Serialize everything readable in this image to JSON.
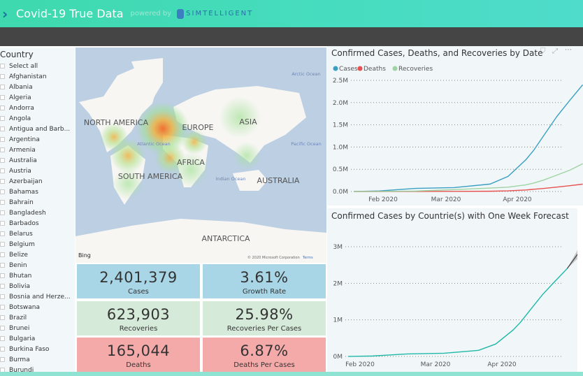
{
  "header": {
    "title": "Covid-19 True Data",
    "powered_by": "powered by",
    "brand": "SIMTELLIGENT",
    "colors": {
      "accent": "#3ed9ae",
      "bar": "#454545"
    }
  },
  "slicer": {
    "title": "Country",
    "items": [
      "Select all",
      "Afghanistan",
      "Albania",
      "Algeria",
      "Andorra",
      "Angola",
      "Antigua and Barb...",
      "Argentina",
      "Armenia",
      "Australia",
      "Austria",
      "Azerbaijan",
      "Bahamas",
      "Bahrain",
      "Bangladesh",
      "Barbados",
      "Belarus",
      "Belgium",
      "Belize",
      "Benin",
      "Bhutan",
      "Bolivia",
      "Bosnia and Herze...",
      "Botswana",
      "Brazil",
      "Brunei",
      "Bulgaria",
      "Burkina Faso",
      "Burma",
      "Burundi"
    ]
  },
  "map": {
    "labels": {
      "na": "NORTH AMERICA",
      "sa": "SOUTH AMERICA",
      "eu": "EUROPE",
      "af": "AFRICA",
      "as": "ASIA",
      "au": "AUSTRALIA",
      "an": "ANTARCTICA",
      "atl": "Atlantic Ocean",
      "ind": "Indian Ocean",
      "pac": "Pacific Ocean",
      "arc": "Arctic Ocean"
    },
    "bing": "Bing",
    "copyright": "© 2020 Microsoft Corporation",
    "terms": "Terms"
  },
  "kpis": [
    {
      "value": "2,401,379",
      "label": "Cases",
      "color": "#a8d6e6"
    },
    {
      "value": "3.61%",
      "label": "Growth Rate",
      "color": "#a8d6e6"
    },
    {
      "value": "623,903",
      "label": "Recoveries",
      "color": "#d5ead8"
    },
    {
      "value": "25.98%",
      "label": "Recoveries Per Cases",
      "color": "#d5ead8"
    },
    {
      "value": "165,044",
      "label": "Deaths",
      "color": "#f5aaaa"
    },
    {
      "value": "6.87%",
      "label": "Deaths Per Cases",
      "color": "#f5aaaa"
    }
  ],
  "chart_data": [
    {
      "type": "line",
      "title": "Confirmed Cases, Deaths, and Recoveries by Date",
      "legend": "top-left",
      "grid": true,
      "xticks": [
        "Feb 2020",
        "Mar 2020",
        "Apr 2020"
      ],
      "yticks": [
        "0.0M",
        "0.5M",
        "1.0M",
        "1.5M",
        "2.0M",
        "2.5M"
      ],
      "ylim": [
        0,
        2.5
      ],
      "x": [
        "2020-01-22",
        "2020-02-01",
        "2020-02-15",
        "2020-03-01",
        "2020-03-15",
        "2020-03-22",
        "2020-03-29",
        "2020-04-01",
        "2020-04-05",
        "2020-04-10",
        "2020-04-15",
        "2020-04-20"
      ],
      "series": [
        {
          "name": "Cases",
          "color": "#3a9fc2",
          "values": [
            0.0006,
            0.012,
            0.069,
            0.088,
            0.167,
            0.34,
            0.72,
            0.93,
            1.27,
            1.69,
            2.05,
            2.4
          ]
        },
        {
          "name": "Deaths",
          "color": "#e8514f",
          "values": [
            0,
            0,
            0.001,
            0.003,
            0.006,
            0.015,
            0.034,
            0.05,
            0.069,
            0.1,
            0.13,
            0.165
          ]
        },
        {
          "name": "Recoveries",
          "color": "#9fd3a3",
          "values": [
            0,
            0.001,
            0.01,
            0.043,
            0.077,
            0.097,
            0.15,
            0.19,
            0.26,
            0.37,
            0.48,
            0.624
          ]
        }
      ]
    },
    {
      "type": "line",
      "title": "Confirmed Cases by Countrie(s) with One Week Forecast",
      "grid": true,
      "xticks": [
        "Feb 2020",
        "Mar 2020",
        "Apr 2020"
      ],
      "yticks": [
        "0M",
        "1M",
        "2M",
        "3M"
      ],
      "ylim": [
        0,
        3
      ],
      "x": [
        "2020-01-22",
        "2020-02-01",
        "2020-02-15",
        "2020-03-01",
        "2020-03-15",
        "2020-03-22",
        "2020-03-29",
        "2020-04-01",
        "2020-04-05",
        "2020-04-10",
        "2020-04-15",
        "2020-04-20"
      ],
      "series": [
        {
          "name": "Cases",
          "color": "#1fb8a8",
          "values": [
            0.0006,
            0.012,
            0.069,
            0.088,
            0.167,
            0.34,
            0.72,
            0.93,
            1.27,
            1.69,
            2.05,
            2.4
          ]
        }
      ],
      "forecast": {
        "color": "#444444",
        "x": [
          "2020-04-20",
          "2020-04-27"
        ],
        "values": [
          2.4,
          3.05
        ],
        "lower": [
          2.4,
          2.85
        ],
        "upper": [
          2.4,
          3.25
        ]
      }
    }
  ]
}
